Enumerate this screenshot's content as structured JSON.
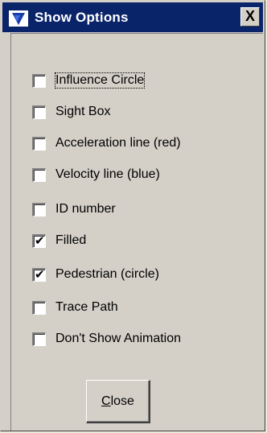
{
  "window": {
    "title": "Show Options",
    "close_glyph": "X",
    "title_icon": "arrow-cursor-icon"
  },
  "options": [
    {
      "label": "Influence Circle",
      "checked": false
    },
    {
      "label": "Sight Box",
      "checked": false
    },
    {
      "label": "Acceleration line (red)",
      "checked": false
    },
    {
      "label": "Velocity line (blue)",
      "checked": false
    },
    {
      "label": "ID number",
      "checked": false
    },
    {
      "label": "Filled",
      "checked": true
    },
    {
      "label": "Pedestrian (circle)",
      "checked": true
    },
    {
      "label": "Trace Path",
      "checked": false
    },
    {
      "label": "Don't Show Animation",
      "checked": false
    }
  ],
  "buttons": {
    "close_label_first": "C",
    "close_label_rest": "lose"
  },
  "colors": {
    "titlebar": "#0a246a",
    "face": "#d4d0c8"
  }
}
